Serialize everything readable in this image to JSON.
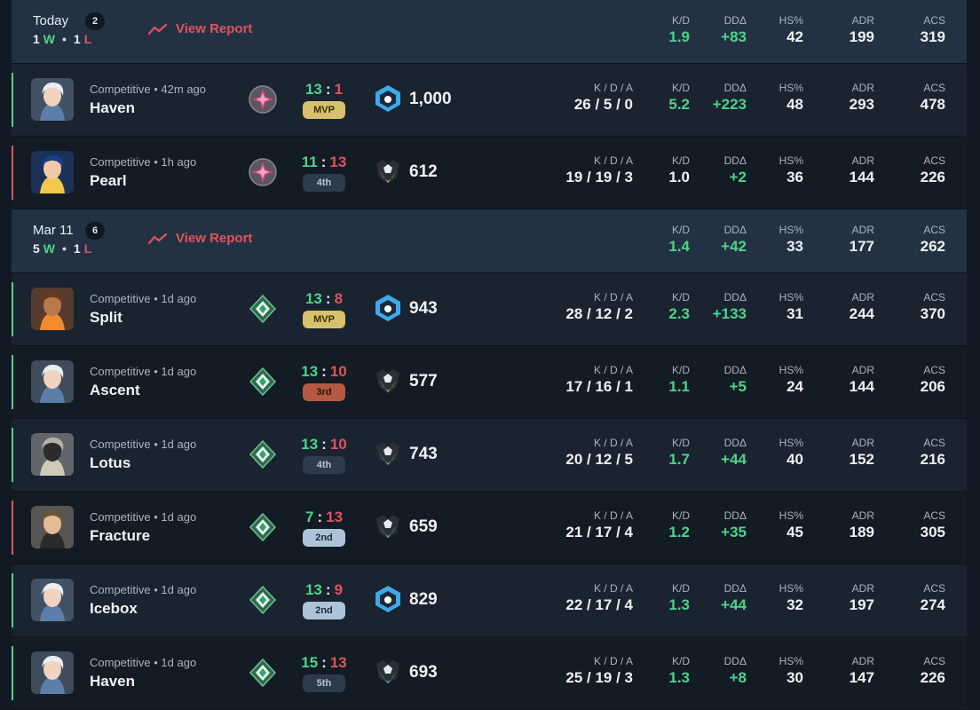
{
  "colors": {
    "win": "#4fd38a",
    "loss": "#e0525e",
    "header_bg": "#233242"
  },
  "stat_labels": {
    "kd": "K/D",
    "dd": "DDΔ",
    "hs": "HS%",
    "adr": "ADR",
    "acs": "ACS",
    "kda": "K / D / A"
  },
  "days": [
    {
      "date": "Today",
      "count": "2",
      "wins": "1",
      "losses": "1",
      "w_label": "W",
      "l_label": "L",
      "view_report": "View Report",
      "summary": {
        "kd": "1.9",
        "dd": "+83",
        "hs": "42",
        "adr": "199",
        "acs": "319"
      },
      "matches": [
        {
          "result": "win",
          "agent": "sage-portrait",
          "mode": "Competitive • 42m ago",
          "map": "Haven",
          "rank_icon": "star-rank-icon",
          "score_won": "13",
          "score_lost": "1",
          "placement": "MVP",
          "badge": "mvp",
          "rr_icon": "blue-tier-icon",
          "rr": "1,000",
          "kda": "26 / 5 / 0",
          "kd": "5.2",
          "dd": "+223",
          "hs": "48",
          "adr": "293",
          "acs": "478",
          "kd_green": true,
          "dd_green": true
        },
        {
          "result": "loss",
          "agent": "neon-portrait",
          "mode": "Competitive • 1h ago",
          "map": "Pearl",
          "rank_icon": "star-rank-icon",
          "score_won": "11",
          "score_lost": "13",
          "placement": "4th",
          "badge": "plain",
          "rr_icon": "gold-tier-icon",
          "rr": "612",
          "kda": "19 / 19 / 3",
          "kd": "1.0",
          "dd": "+2",
          "hs": "36",
          "adr": "144",
          "acs": "226",
          "kd_green": false,
          "dd_green": true
        }
      ]
    },
    {
      "date": "Mar 11",
      "count": "6",
      "wins": "5",
      "losses": "1",
      "w_label": "W",
      "l_label": "L",
      "view_report": "View Report",
      "summary": {
        "kd": "1.4",
        "dd": "+42",
        "hs": "33",
        "adr": "177",
        "acs": "262"
      },
      "matches": [
        {
          "result": "win",
          "agent": "raze-portrait",
          "mode": "Competitive • 1d ago",
          "map": "Split",
          "rank_icon": "emerald-rank-icon",
          "score_won": "13",
          "score_lost": "8",
          "placement": "MVP",
          "badge": "mvp",
          "rr_icon": "blue-tier-icon",
          "rr": "943",
          "kda": "28 / 12 / 2",
          "kd": "2.3",
          "dd": "+133",
          "hs": "31",
          "adr": "244",
          "acs": "370",
          "kd_green": true,
          "dd_green": true
        },
        {
          "result": "win",
          "agent": "sage-portrait",
          "mode": "Competitive • 1d ago",
          "map": "Ascent",
          "rank_icon": "emerald-rank-icon",
          "score_won": "13",
          "score_lost": "10",
          "placement": "3rd",
          "badge": "third",
          "rr_icon": "gold-tier-icon",
          "rr": "577",
          "kda": "17 / 16 / 1",
          "kd": "1.1",
          "dd": "+5",
          "hs": "24",
          "adr": "144",
          "acs": "206",
          "kd_green": true,
          "dd_green": true
        },
        {
          "result": "win",
          "agent": "cypher-portrait",
          "mode": "Competitive • 1d ago",
          "map": "Lotus",
          "rank_icon": "emerald-rank-icon",
          "score_won": "13",
          "score_lost": "10",
          "placement": "4th",
          "badge": "plain",
          "rr_icon": "green-tier-icon",
          "rr": "743",
          "kda": "20 / 12 / 5",
          "kd": "1.7",
          "dd": "+44",
          "hs": "40",
          "adr": "152",
          "acs": "216",
          "kd_green": true,
          "dd_green": true
        },
        {
          "result": "loss",
          "agent": "chamber-portrait",
          "mode": "Competitive • 1d ago",
          "map": "Fracture",
          "rank_icon": "emerald-rank-icon",
          "score_won": "7",
          "score_lost": "13",
          "placement": "2nd",
          "badge": "second",
          "rr_icon": "green-tier-icon",
          "rr": "659",
          "kda": "21 / 17 / 4",
          "kd": "1.2",
          "dd": "+35",
          "hs": "45",
          "adr": "189",
          "acs": "305",
          "kd_green": true,
          "dd_green": true
        },
        {
          "result": "win",
          "agent": "sage-portrait",
          "mode": "Competitive • 1d ago",
          "map": "Icebox",
          "rank_icon": "emerald-rank-icon",
          "score_won": "13",
          "score_lost": "9",
          "placement": "2nd",
          "badge": "second",
          "rr_icon": "blue-tier-icon",
          "rr": "829",
          "kda": "22 / 17 / 4",
          "kd": "1.3",
          "dd": "+44",
          "hs": "32",
          "adr": "197",
          "acs": "274",
          "kd_green": true,
          "dd_green": true
        },
        {
          "result": "win",
          "agent": "sage-portrait",
          "mode": "Competitive • 1d ago",
          "map": "Haven",
          "rank_icon": "emerald-rank-icon",
          "score_won": "15",
          "score_lost": "13",
          "placement": "5th",
          "badge": "plain",
          "rr_icon": "green-tier-icon",
          "rr": "693",
          "kda": "25 / 19 / 3",
          "kd": "1.3",
          "dd": "+8",
          "hs": "30",
          "adr": "147",
          "acs": "226",
          "kd_green": true,
          "dd_green": true
        }
      ]
    }
  ]
}
